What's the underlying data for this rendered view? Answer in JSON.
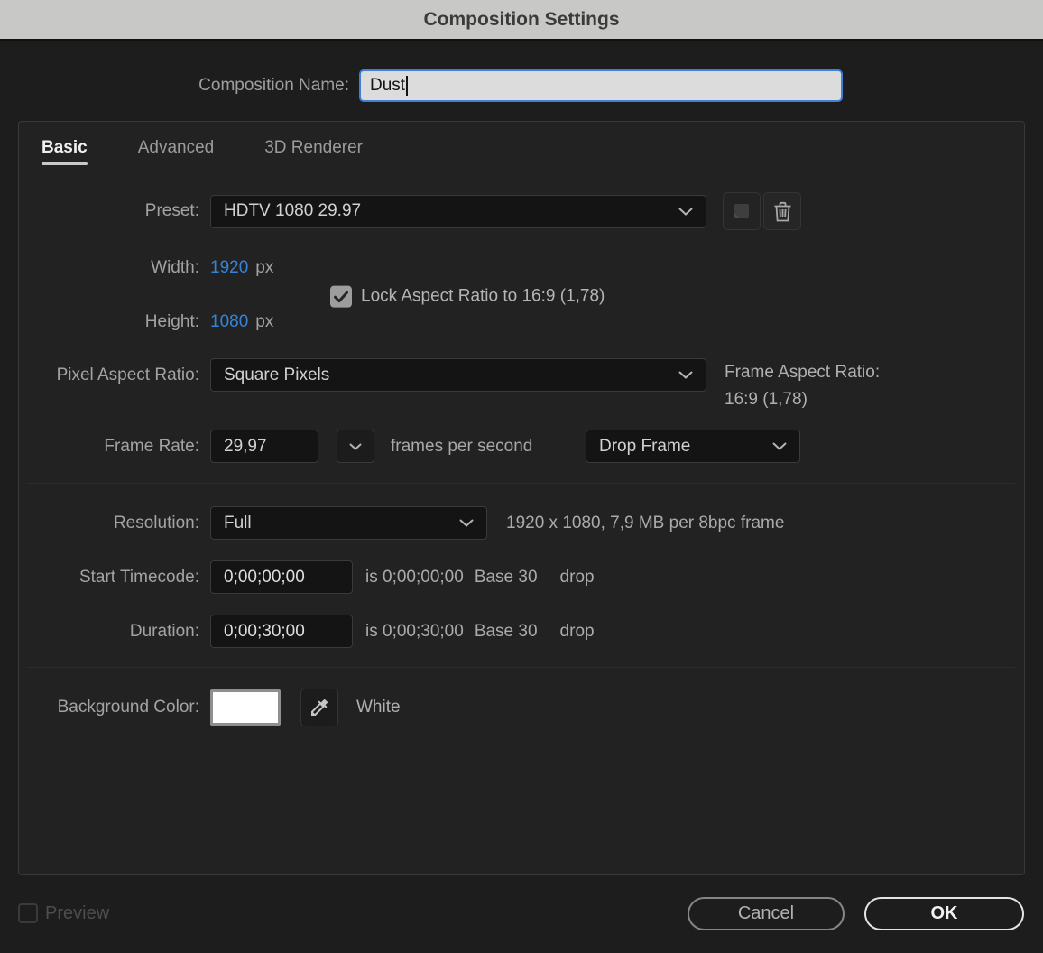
{
  "window": {
    "title": "Composition Settings"
  },
  "composition_name": {
    "label": "Composition Name:",
    "value": "Dust"
  },
  "tabs": [
    {
      "label": "Basic",
      "active": true
    },
    {
      "label": "Advanced",
      "active": false
    },
    {
      "label": "3D Renderer",
      "active": false
    }
  ],
  "basic": {
    "preset": {
      "label": "Preset:",
      "value": "HDTV 1080 29.97"
    },
    "width": {
      "label": "Width:",
      "value": "1920",
      "unit": "px"
    },
    "height": {
      "label": "Height:",
      "value": "1080",
      "unit": "px"
    },
    "lock_aspect": {
      "label": "Lock Aspect Ratio to 16:9 (1,78)",
      "checked": true
    },
    "pixel_aspect_ratio": {
      "label": "Pixel Aspect Ratio:",
      "value": "Square Pixels"
    },
    "frame_aspect_ratio": {
      "label": "Frame Aspect Ratio:",
      "value": "16:9 (1,78)"
    },
    "frame_rate": {
      "label": "Frame Rate:",
      "value": "29,97",
      "unit": "frames per second",
      "timecode_type": "Drop Frame"
    },
    "resolution": {
      "label": "Resolution:",
      "value": "Full",
      "info": "1920 x 1080, 7,9 MB per 8bpc frame"
    },
    "start_timecode": {
      "label": "Start Timecode:",
      "value": "0;00;00;00",
      "equals": "is 0;00;00;00",
      "base": "Base 30",
      "drop": "drop"
    },
    "duration": {
      "label": "Duration:",
      "value": "0;00;30;00",
      "equals": "is 0;00;30;00",
      "base": "Base 30",
      "drop": "drop"
    },
    "background_color": {
      "label": "Background Color:",
      "value": "White",
      "swatch_hex": "#ffffff"
    }
  },
  "footer": {
    "preview_label": "Preview",
    "preview_checked": false,
    "cancel_label": "Cancel",
    "ok_label": "OK"
  },
  "icons": {
    "dropdown_chevron": "chevron-down",
    "save_preset": "folded-corner-square",
    "delete_preset": "trash",
    "lock_check": "checkmark",
    "eyedropper": "eyedropper",
    "text_caret": "text-cursor"
  },
  "colors": {
    "titlebar_bg": "#c8c8c7",
    "accent_blue": "#3584d8",
    "focus_border": "#3f7fd6",
    "panel_bg": "#222222",
    "dialog_bg": "#1d1d1d"
  }
}
